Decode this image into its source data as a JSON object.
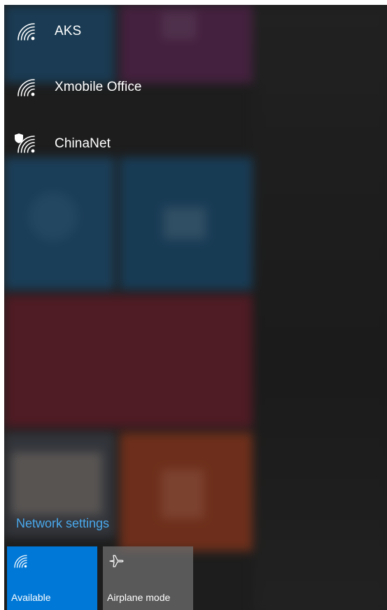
{
  "networks": [
    {
      "name": "AKS",
      "icon": "wifi-icon",
      "secured": false
    },
    {
      "name": "Xmobile Office",
      "icon": "wifi-icon",
      "secured": false
    },
    {
      "name": "ChinaNet",
      "icon": "wifi-icon",
      "secured": true
    }
  ],
  "network_settings_label": "Network settings",
  "quick_actions": {
    "wifi": {
      "label": "Available",
      "icon": "wifi-icon",
      "active": true
    },
    "airplane": {
      "label": "Airplane mode",
      "icon": "airplane-icon",
      "active": false
    }
  },
  "colors": {
    "accent": "#0078d7",
    "link": "#4aa8ec",
    "text": "#ffffff"
  }
}
